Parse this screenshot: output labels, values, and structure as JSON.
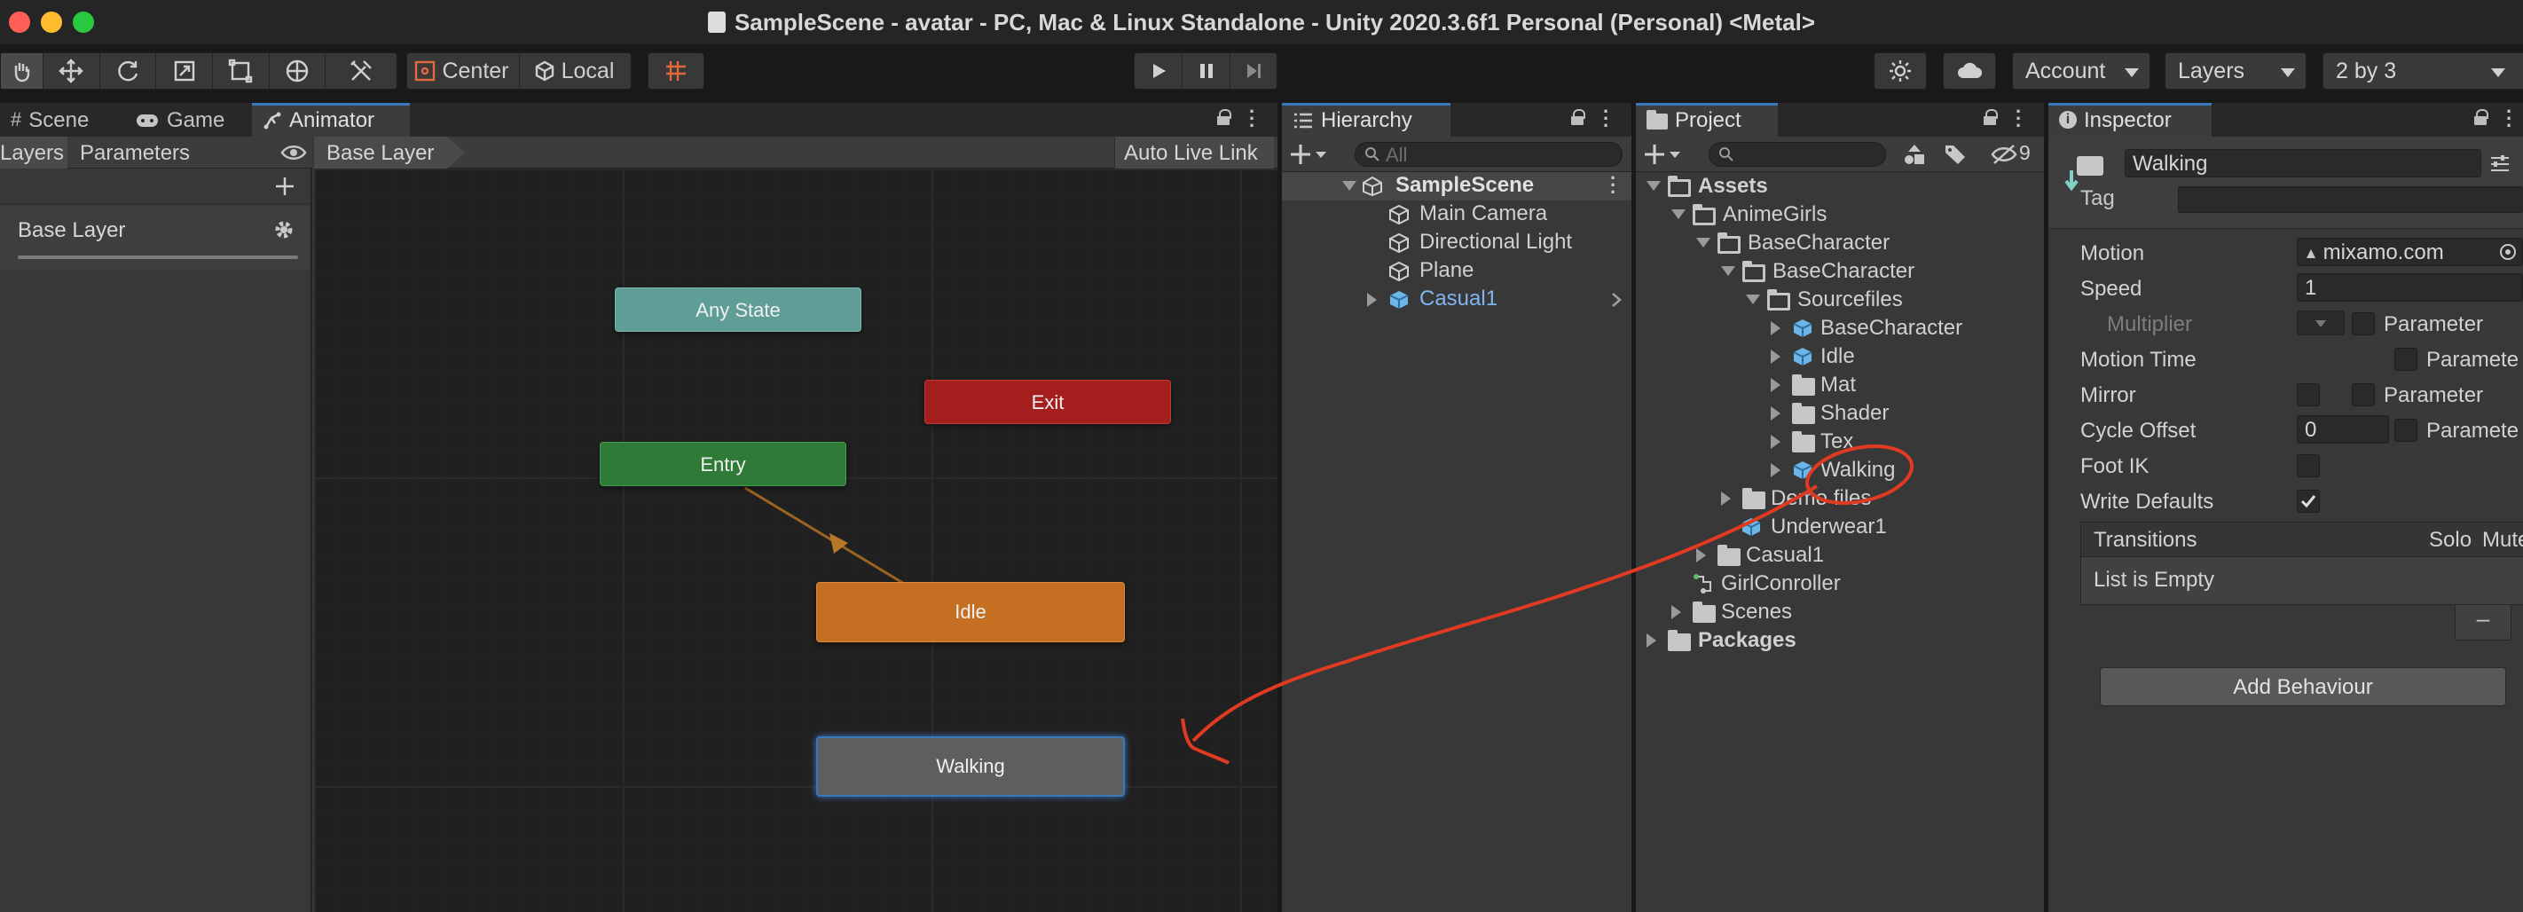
{
  "window": {
    "title": "SampleScene - avatar - PC, Mac & Linux Standalone - Unity 2020.3.6f1 Personal (Personal) <Metal>"
  },
  "toolbar": {
    "pivot_label": "Center",
    "space_label": "Local",
    "account_label": "Account",
    "layers_label": "Layers",
    "layout_label": "2 by 3"
  },
  "tabs": {
    "scene": "Scene",
    "game": "Game",
    "animator": "Animator",
    "hierarchy": "Hierarchy",
    "project": "Project",
    "inspector": "Inspector"
  },
  "animator": {
    "subtabs": [
      "Layers",
      "Parameters"
    ],
    "breadcrumb": "Base Layer",
    "auto_live_link": "Auto Live Link",
    "layer_name": "Base Layer",
    "states": {
      "any_state": "Any State",
      "exit": "Exit",
      "entry": "Entry",
      "idle": "Idle",
      "walking": "Walking"
    }
  },
  "hierarchy": {
    "search_placeholder": "All",
    "scene_name": "SampleScene",
    "items": [
      "Main Camera",
      "Directional Light",
      "Plane",
      "Casual1"
    ]
  },
  "project": {
    "hidden_count": "9",
    "tree": [
      "Assets",
      "AnimeGirls",
      "BaseCharacter",
      "BaseCharacter",
      "Sourcefiles",
      "BaseCharacter",
      "Idle",
      "Mat",
      "Shader",
      "Tex",
      "Walking",
      "Demo files",
      "Underwear1",
      "Casual1",
      "GirlConroller",
      "Scenes",
      "Packages"
    ]
  },
  "inspector": {
    "name": "Walking",
    "tag_label": "Tag",
    "motion_label": "Motion",
    "motion_value": "mixamo.com",
    "speed_label": "Speed",
    "speed_value": "1",
    "multiplier_label": "Multiplier",
    "parameter_label": "Parameter",
    "motion_time_label": "Motion Time",
    "parameter_cut": "Paramete",
    "mirror_label": "Mirror",
    "cycle_offset_label": "Cycle Offset",
    "cycle_offset_value": "0",
    "foot_ik_label": "Foot IK",
    "write_defaults_label": "Write Defaults",
    "transitions_label": "Transitions",
    "solo_label": "Solo",
    "mute_label": "Mute",
    "list_empty": "List is Empty",
    "minus": "–",
    "add_behaviour": "Add Behaviour"
  },
  "colors": {
    "any_state": "#5f9e96",
    "exit": "#a51e1e",
    "entry": "#2f7a37",
    "idle": "#c46f22",
    "walking": "#5e5e5e",
    "selection_blue": "#3a79bb",
    "annotation_red": "#e03a23"
  }
}
